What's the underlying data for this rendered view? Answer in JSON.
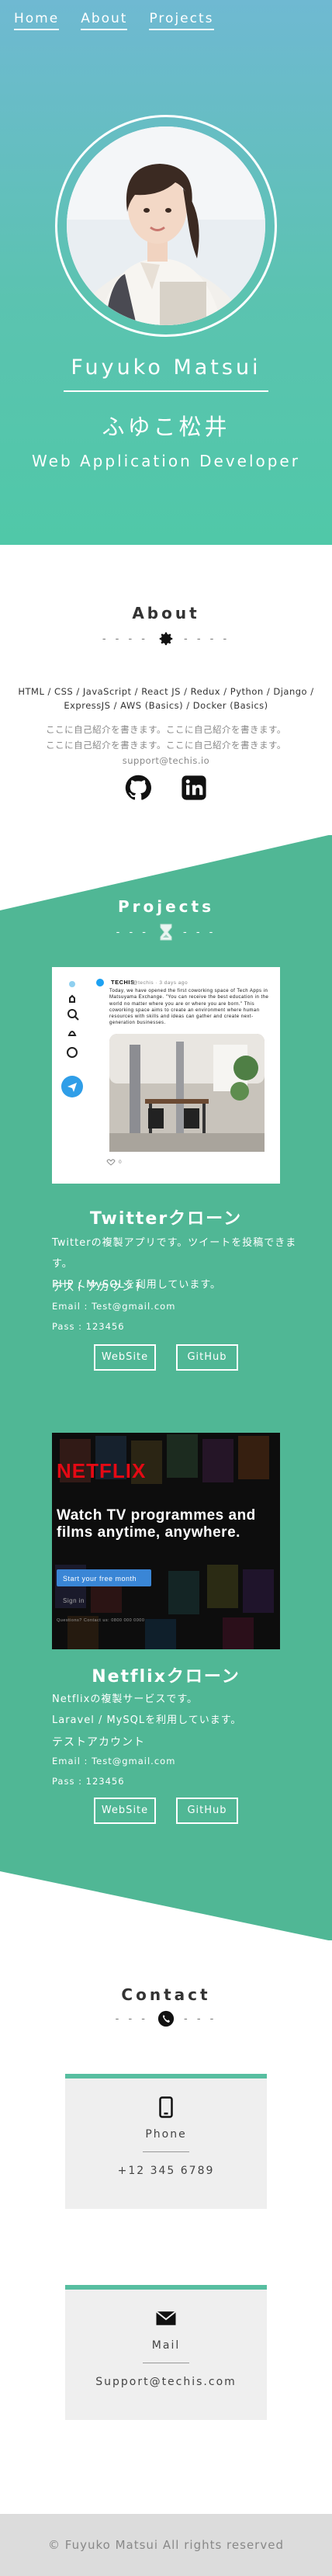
{
  "nav": {
    "items": [
      "Home",
      "About",
      "Projects"
    ]
  },
  "hero": {
    "name": "Fuyuko Matsui",
    "name_kana": "ふゆこ松井",
    "role": "Web Application Developer"
  },
  "about": {
    "title": "About",
    "divider": "- - - -",
    "skills": "HTML / CSS / JavaScript / React JS / Redux / Python / Django / ExpressJS / AWS (Basics) / Docker (Basics)",
    "intro": [
      "ここに自己紹介を書きます。ここに自己紹介を書きます。",
      "ここに自己紹介を書きます。ここに自己紹介を書きます。"
    ],
    "email": "support@techis.io",
    "socials": [
      "github-icon",
      "linkedin-icon"
    ]
  },
  "projects": {
    "title": "Projects",
    "divider": "- - -",
    "items": [
      {
        "title": "Twitterクローン",
        "desc": "Twitterの複製アプリです。ツイートを投稿できます。",
        "stack": "PHP / MySQLを利用しています。",
        "account_label": "テストアカウント",
        "email": "Email : Test@gmail.com",
        "pass": "Pass : 123456",
        "buttons": [
          "WebSite",
          "GitHub"
        ],
        "preview": {
          "handle": "TECHIS",
          "handle_id": "@techis · 3 days ago",
          "tweet": "Today, we have opened the first coworking space of Tech Apps in Matsuyama Exchange. \"You can receive the best education in the world no matter where you are or where you are born.\" This coworking space aims to create an environment where human resources with skills and ideas can gather and create next-generation businesses.",
          "likes": "0"
        }
      },
      {
        "title": "Netflixクローン",
        "desc": "Netflixの複製サービスです。",
        "stack": "Laravel / MySQLを利用しています。",
        "account_label": "テストアカウント",
        "email": "Email : Test@gmail.com",
        "pass": "Pass : 123456",
        "buttons": [
          "WebSite",
          "GitHub"
        ],
        "preview": {
          "logo": "NETFLIX",
          "headline": "Watch TV programmes and films anytime, anywhere.",
          "cta": "Start your free month",
          "signin": "Sign in",
          "footer": "Questions? Contact us: 0800 000 0000"
        }
      }
    ]
  },
  "contact": {
    "title": "Contact",
    "divider": "- - -",
    "cards": [
      {
        "icon": "phone-icon",
        "label": "Phone",
        "value": "+12 345 6789"
      },
      {
        "icon": "envelope-icon",
        "label": "Mail",
        "value": "Support@techis.com"
      }
    ]
  },
  "footer": {
    "text": "© Fuyuko Matsui All rights reserved"
  },
  "colors": {
    "accent": "#50b795",
    "hero_top": "#6fb9d2",
    "hero_bottom": "#50c8a8",
    "footer_bg": "#dcdcdc"
  }
}
